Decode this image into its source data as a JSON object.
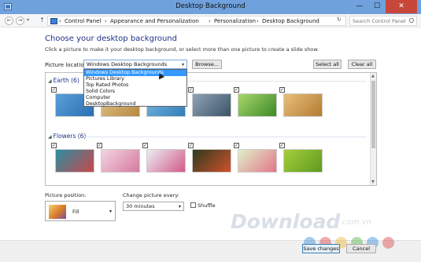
{
  "window": {
    "title": "Desktop Background",
    "min": "—",
    "max": "☐",
    "close": "✕"
  },
  "address": {
    "back": "←",
    "forward": "→",
    "history": "▾",
    "up": "↑",
    "crumbs": [
      "Control Panel",
      "Appearance and Personalization",
      "Personalization",
      "Desktop Background"
    ],
    "separator": "›",
    "refresh": "↻",
    "search_placeholder": "Search Control Panel"
  },
  "content": {
    "heading": "Choose your desktop background",
    "subtitle": "Click a picture to make it your desktop background, or select more than one picture to create a slide show.",
    "location_label": "Picture location:",
    "location_value": "Windows Desktop Backgrounds",
    "location_options": [
      "Windows Desktop Backgrounds",
      "Pictures Library",
      "Top Rated Photos",
      "Solid Colors",
      "Computer",
      "DesktopBackground"
    ],
    "browse": "Browse...",
    "select_all": "Select all",
    "clear_all": "Clear all"
  },
  "gallery": {
    "groups": [
      {
        "name": "Earth (6)",
        "colors": [
          [
            "#5aa0d8",
            "#2b6fb3"
          ],
          [
            "#e0c58a",
            "#b8873f"
          ],
          [
            "#7ab6e0",
            "#2f7db8"
          ],
          [
            "#8fa3b6",
            "#3c5367"
          ],
          [
            "#a8d66a",
            "#3c8a2a"
          ],
          [
            "#e8c07a",
            "#b47a32"
          ]
        ]
      },
      {
        "name": "Flowers (6)",
        "colors": [
          [
            "#2a8fa3",
            "#c8464a"
          ],
          [
            "#f3d4e0",
            "#d67aa0"
          ],
          [
            "#e9eef2",
            "#d45a8a"
          ],
          [
            "#2b3a1e",
            "#d0512b"
          ],
          [
            "#dff0c8",
            "#e4758a"
          ],
          [
            "#a4cf3c",
            "#5f9a1f"
          ]
        ]
      }
    ],
    "checkmark": "✓",
    "collapse_chevron": "◢"
  },
  "options": {
    "position_label": "Picture position:",
    "position_value": "Fill",
    "change_label": "Change picture every:",
    "change_value": "30 minutes",
    "shuffle_label": "Shuffle",
    "dropdown_arrow": "▾"
  },
  "footer": {
    "save": "Save changes",
    "cancel": "Cancel"
  },
  "watermark": {
    "text": "Download",
    "sub": ".com.vn"
  },
  "colors": {
    "accent": "#1e3287",
    "title_bar": "#6fa1dc",
    "close": "#c7473b",
    "highlight": "#3399ff"
  }
}
